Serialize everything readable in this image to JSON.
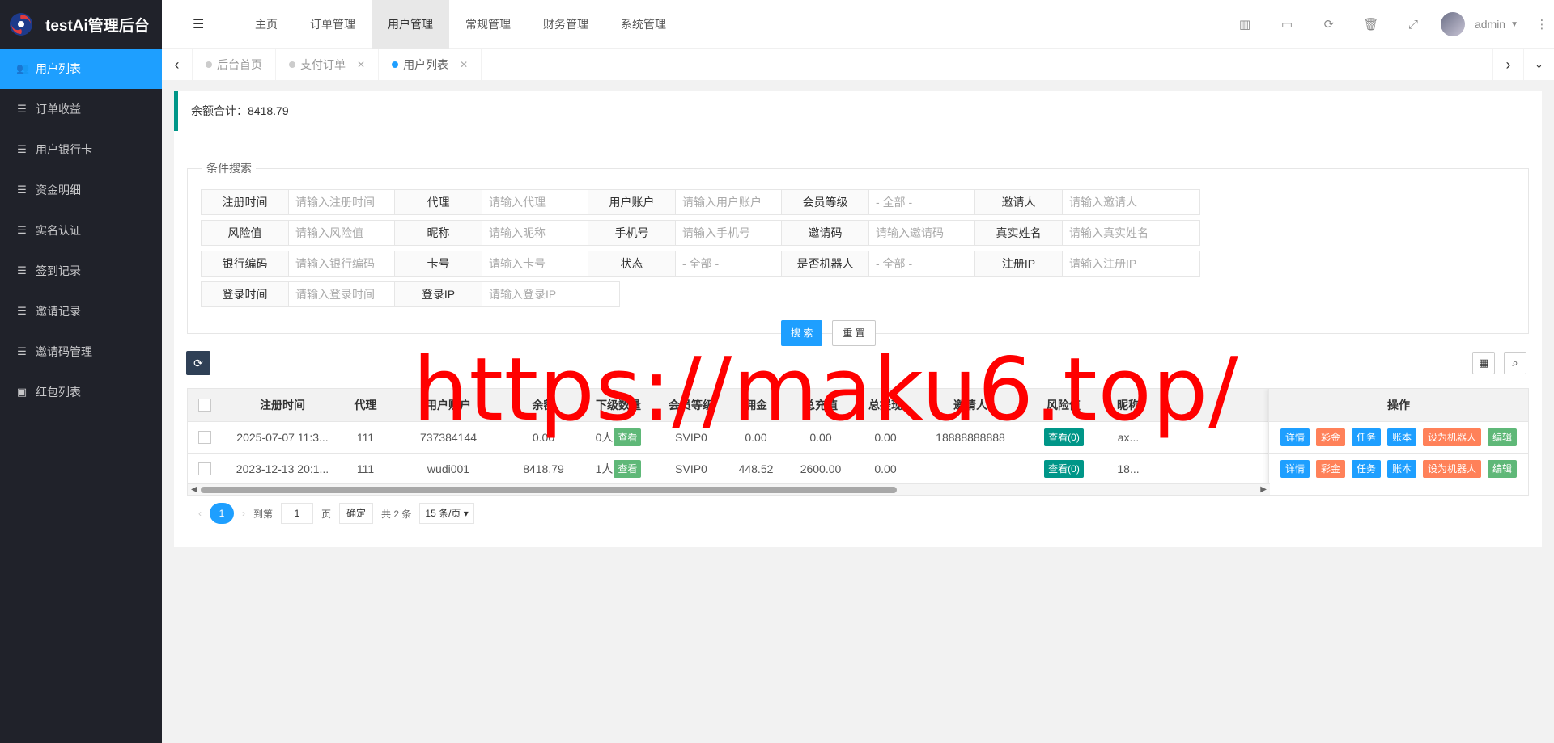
{
  "app_title": "testAi管理后台",
  "sidebar": {
    "items": [
      {
        "label": "用户列表",
        "icon": "users-icon",
        "active": true
      },
      {
        "label": "订单收益",
        "icon": "list-icon"
      },
      {
        "label": "用户银行卡",
        "icon": "list-icon"
      },
      {
        "label": "资金明细",
        "icon": "list-icon"
      },
      {
        "label": "实名认证",
        "icon": "list-icon"
      },
      {
        "label": "签到记录",
        "icon": "list-icon"
      },
      {
        "label": "邀请记录",
        "icon": "list-icon"
      },
      {
        "label": "邀请码管理",
        "icon": "list-icon"
      },
      {
        "label": "红包列表",
        "icon": "redpacket-icon"
      }
    ]
  },
  "header": {
    "nav": [
      "主页",
      "订单管理",
      "用户管理",
      "常规管理",
      "财务管理",
      "系统管理"
    ],
    "active_nav": "用户管理",
    "username": "admin"
  },
  "tabs": [
    {
      "label": "后台首页"
    },
    {
      "label": "支付订单"
    },
    {
      "label": "用户列表",
      "active": true
    }
  ],
  "summary": "余额合计：8418.79",
  "search": {
    "legend": "条件搜索",
    "fields": [
      {
        "label": "注册时间",
        "placeholder": "请输入注册时间"
      },
      {
        "label": "代理",
        "placeholder": "请输入代理"
      },
      {
        "label": "用户账户",
        "placeholder": "请输入用户账户"
      },
      {
        "label": "会员等级",
        "placeholder": "- 全部 -",
        "select": true
      },
      {
        "label": "邀请人",
        "placeholder": "请输入邀请人"
      },
      {
        "label": "风险值",
        "placeholder": "请输入风险值"
      },
      {
        "label": "昵称",
        "placeholder": "请输入昵称"
      },
      {
        "label": "手机号",
        "placeholder": "请输入手机号"
      },
      {
        "label": "邀请码",
        "placeholder": "请输入邀请码"
      },
      {
        "label": "真实姓名",
        "placeholder": "请输入真实姓名"
      },
      {
        "label": "银行编码",
        "placeholder": "请输入银行编码"
      },
      {
        "label": "卡号",
        "placeholder": "请输入卡号"
      },
      {
        "label": "状态",
        "placeholder": "- 全部 -",
        "select": true
      },
      {
        "label": "是否机器人",
        "placeholder": "- 全部 -",
        "select": true
      },
      {
        "label": "注册IP",
        "placeholder": "请输入注册IP"
      },
      {
        "label": "登录时间",
        "placeholder": "请输入登录时间"
      },
      {
        "label": "登录IP",
        "placeholder": "请输入登录IP"
      }
    ],
    "search_btn": "搜 索",
    "reset_btn": "重 置"
  },
  "table": {
    "headers": [
      "注册时间",
      "代理",
      "用户账户",
      "余额",
      "下级数量",
      "会员等级",
      "佣金",
      "总充值",
      "总提现",
      "邀请人",
      "风险值",
      "昵称"
    ],
    "rows": [
      {
        "reg": "2025-07-07 11:3...",
        "agent": "111",
        "account": "737384144",
        "balance": "0.00",
        "sub": "0人",
        "level": "SVIP0",
        "comm": "0.00",
        "recharge": "0.00",
        "withdraw": "0.00",
        "inviter": "18888888888",
        "risk": "查看(0)",
        "nick": "ax..."
      },
      {
        "reg": "2023-12-13 20:1...",
        "agent": "111",
        "account": "wudi001",
        "balance": "8418.79",
        "sub": "1人",
        "level": "SVIP0",
        "comm": "448.52",
        "recharge": "2600.00",
        "withdraw": "0.00",
        "inviter": "",
        "risk": "查看(0)",
        "nick": "18..."
      }
    ],
    "view_label": "查看",
    "ops_header": "操作",
    "ops": [
      "详情",
      "彩金",
      "任务",
      "账本",
      "设为机器人",
      "编辑"
    ]
  },
  "pager": {
    "current": "1",
    "goto_prefix": "到第",
    "goto_value": "1",
    "page_suffix": "页",
    "confirm": "确定",
    "total": "共 2 条",
    "per_page": "15 条/页"
  },
  "watermark": "https://maku6.top/",
  "colors": {
    "sidebar": "#20222a",
    "accent": "#1e9fff",
    "teal": "#009688",
    "green": "#5fb878",
    "red": "#ff5722"
  }
}
